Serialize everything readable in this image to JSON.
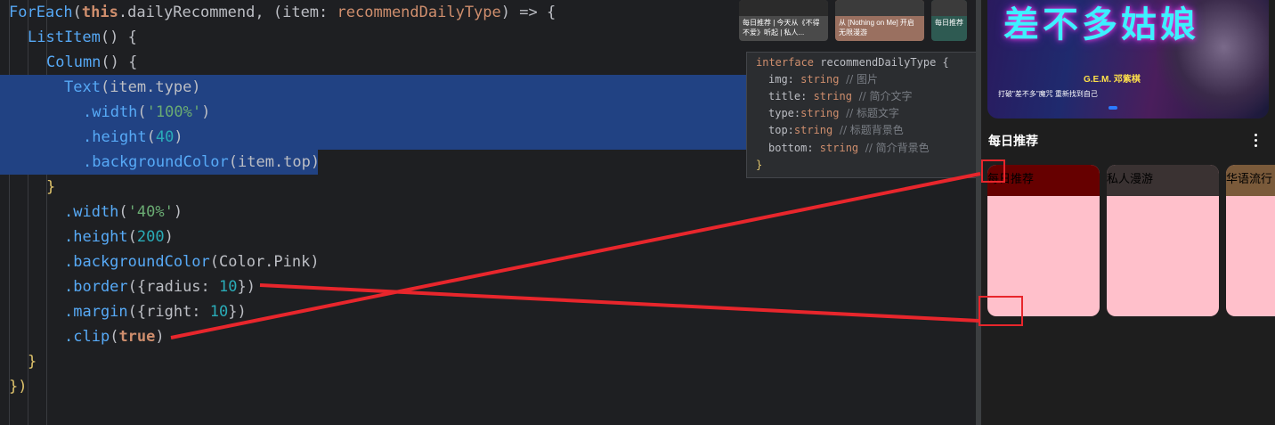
{
  "code": {
    "line1": {
      "foreach": "ForEach",
      "open": "(",
      "this": "this",
      "rest": ".dailyRecommend, (",
      "param": "item",
      "colon": ": ",
      "type": "recommendDailyType",
      "arrow": ") => {"
    },
    "line2": {
      "fn": "ListItem",
      "tail": "() {"
    },
    "line3": {
      "fn": "Column",
      "tail": "() {"
    },
    "line4": {
      "fn": "Text",
      "tail": "(item.type)"
    },
    "line5": {
      "attr": ".width",
      "open": "(",
      "str": "'100%'",
      "close": ")"
    },
    "line6": {
      "attr": ".height",
      "open": "(",
      "num": "40",
      "close": ")"
    },
    "line7": {
      "attr": ".backgroundColor",
      "tail": "(item.top)"
    },
    "line8": {
      "text": "}"
    },
    "line9": {
      "attr": ".width",
      "open": "(",
      "str": "'40%'",
      "close": ")"
    },
    "line10": {
      "attr": ".height",
      "open": "(",
      "num": "200",
      "close": ")"
    },
    "line11": {
      "attr": ".backgroundColor",
      "tail": "(Color.Pink)"
    },
    "line12": {
      "attr": ".border",
      "open": "({radius: ",
      "num": "10",
      "close": "})"
    },
    "line13": {
      "attr": ".margin",
      "open": "({right: ",
      "num": "10",
      "close": "})"
    },
    "line14": {
      "attr": ".clip",
      "open": "(",
      "kw": "true",
      "close": ")"
    },
    "line15": {
      "text": "}"
    },
    "line16": {
      "text": "})"
    }
  },
  "tooltip": {
    "l1_kw": "interface",
    "l1_name": " recommendDailyType {",
    "l2_key": "img: ",
    "l2_type": "string",
    "l2_cm": "  // 图片",
    "l3_key": "title: ",
    "l3_type": "string",
    "l3_cm": "  // 简介文字",
    "l4_key": "type:",
    "l4_type": "string",
    "l4_cm": "  // 标题文字",
    "l5_key": "top:",
    "l5_type": "string",
    "l5_cm": "  // 标题背景色",
    "l6_key": "bottom: ",
    "l6_type": "string",
    "l6_cm": "  // 简介背景色",
    "l7": "}"
  },
  "thumbs": [
    {
      "caption": "每日推荐 | 今天从《不得不爱》听起 | 私人..."
    },
    {
      "caption": "从 [Nothing on Me] 开启无限漫游"
    },
    {
      "caption": "每日推荐"
    }
  ],
  "banner": {
    "title": "差不多姑娘",
    "artist": "G.E.M. 邓紫棋",
    "slogan": "打破\"差不多\"魔咒  重新找到自己"
  },
  "section": {
    "title": "每日推荐"
  },
  "cards": [
    {
      "label": "每日推荐",
      "top_color": "#660000"
    },
    {
      "label": "私人漫游",
      "top_color": "#3a3232"
    },
    {
      "label": "华语流行",
      "top_color": "#7a5a3a"
    }
  ],
  "colors": {
    "card_body": "#ffc0cb",
    "annotation_red": "#e8262c",
    "selection": "#214283"
  }
}
